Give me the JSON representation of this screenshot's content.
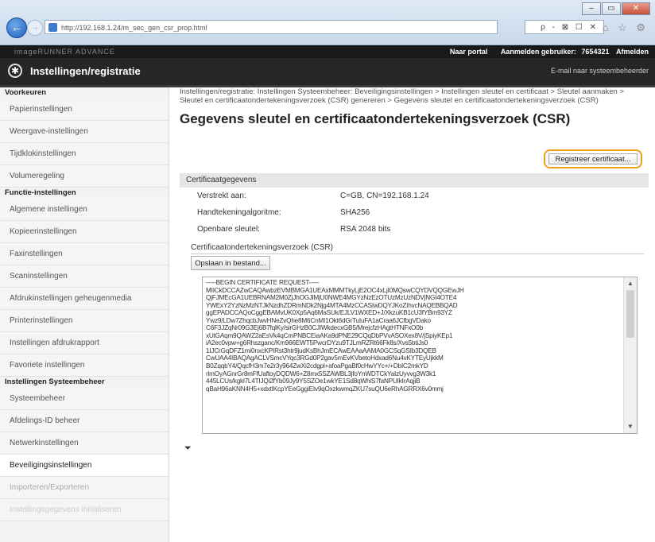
{
  "browser": {
    "url": "http://192.168.1.24/m_sec_gen_csr_prop.html",
    "tools": "ρ - ⊠ ☐ ✕",
    "icons": "⌂ ☆ ⚙",
    "window_buttons": [
      "–",
      "▭",
      "✕"
    ]
  },
  "topbar": {
    "device": "imageRUNNER ADVANCE",
    "portal": "Naar portal",
    "user_label": "Aanmelden gebruiker:",
    "user_id": "7654321",
    "logout": "Afmelden"
  },
  "header": {
    "title": "Instellingen/registratie",
    "mail_link": "E-mail naar systeembeheerder"
  },
  "sidebar": {
    "groups": [
      {
        "heading": "Voorkeuren",
        "items": [
          "Papierinstellingen",
          "Weergave-instellingen",
          "Tijdklokinstellingen",
          "Volumeregeling"
        ]
      },
      {
        "heading": "Functie-instellingen",
        "items": [
          "Algemene instellingen",
          "Kopieerinstellingen",
          "Faxinstellingen",
          "Scaninstellingen",
          "Afdrukinstellingen geheugenmedia",
          "Printerinstellingen",
          "Instellingen afdrukrapport",
          "Favoriete instellingen"
        ]
      },
      {
        "heading": "Instellingen Systeembeheer",
        "items": [
          "Systeembeheer",
          "Afdelings-ID beheer",
          "Netwerkinstellingen",
          "Beveiligingsinstellingen",
          "Importeren/Exporteren",
          "Instellingsgegevens initialiseren"
        ]
      }
    ]
  },
  "main": {
    "breadcrumb": "Instellingen/registratie: Instellingen Systeembeheer: Beveiligingsinstellingen > Instellingen sleutel en certificaat > Sleutel aanmaken > Sleutel en certificaatondertekeningsverzoek (CSR) genereren > Gegevens sleutel en certificaatondertekeningsverzoek (CSR)",
    "title": "Gegevens sleutel en certificaatondertekeningsverzoek (CSR)",
    "register_button": "Registreer certificaat...",
    "section_heading": "Certificaatgegevens",
    "rows": [
      {
        "label": "Verstrekt aan:",
        "value": "C=GB, CN=192.168.1.24"
      },
      {
        "label": "Handtekeningalgoritme:",
        "value": "SHA256"
      },
      {
        "label": "Openbare sleutel:",
        "value": "RSA 2048 bits"
      }
    ],
    "csr_label": "Certificaatondertekeningsverzoek (CSR)",
    "save_button": "Opslaan in bestand...",
    "csr_text": "-----BEGIN CERTIFICATE REQUEST-----\nMIICkDCCAZwCAQAwbzEVMBMGA1UEAxMMMTkyLjE2OC4xLjI0MQswCQYDVQQGEwJH\nQjFJMEcGA1UEBRNAM2M0ZjJhOGJlMjU0NWE4MGYzNzEzOTUzMzUzNDVjNGI4OTE4\nYWExY2YzNzMzNTJkNzdhZDRmNDk2Njg4MTA4MzCCASIwDQYJKoZIhvcNAQEBBQAD\nggEPADCCAQoCggEBAMvUK0Xp5Aq6MaSUk/EJLV1WXED+J/XkzuKB1cU3fYBm93YZ\nYwz9/LDw7ZhqcbJwvHNeZvQhe8M6CnMI1Okt6dGrTuIuFA1aCraa6JCfbgVDako\nC6F3JZqNr09G3Ej6B7fqlKy/sirGHzB0CJIWkdecxGB5/MrejcfzHAgtHTNFxO0b\nxUtGAqm9QAWZ2aEsVk4qCmPNBCEiaAKa9dPNE29CQqDbPVvASOXex8V/jSpiyKEp1\niA2ec0vpw+g6Rhszganc/Km966EWT5PwcrDYzu9TJLmRZRt66Fk8s/Xvs5btiJs0\n1IJCrGqDFZ1mi0nxcKPIRst3htr9judKsBhJmECAwEAAaAAMA0GCSqGSIb3DQEB\nCwUAA4IBAQAgACLVSmcVYqc3RGd0P2gav5mEvKVbetoHdxad6Nu4vKYTEyUjkkM\nB0ZqqbY4/QqcfH3m7e2r3y964ZwXi2cdgpl+afoaPgaBf0cHwYYc+/+DbIC2mkYD\nrlmOyAGnrGr8mFfUaftoyDQDW6+Z8mx5SZAWBL3jfoYnWDTCkYaIzUyvvg3W3k1\n445LCUs/kgkl7L4TIJQi2fYb09Jy9Y5SZOe1wkYE1Sd8qWhiS7faNPUIkIrAqjiB\nqBaH96aKNN4H5+xdxtIKcpYEeGggiEIv9qOxzkwmqZKU7suQU6eRhAGRRX6v0mmj"
  },
  "to_bottom_icon": "⏷"
}
